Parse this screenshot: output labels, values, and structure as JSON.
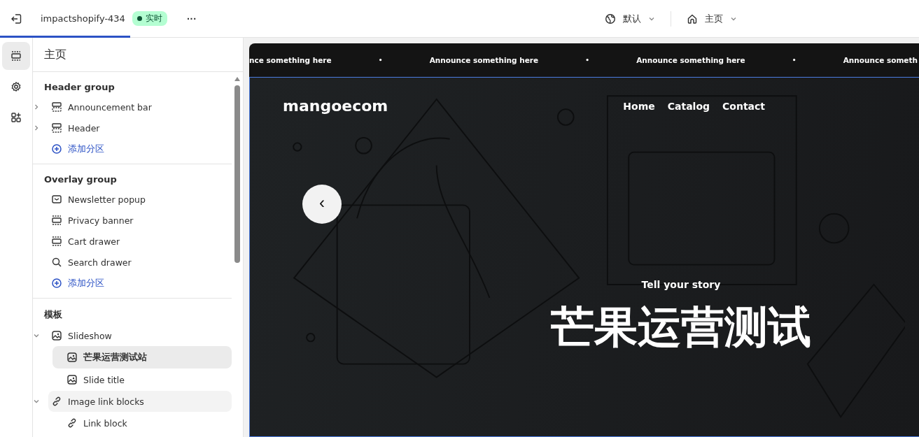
{
  "topbar": {
    "store_name": "impactshopify-434",
    "status_badge": "实时",
    "more": "···",
    "language": "默认",
    "page": "主页"
  },
  "rail": [
    {
      "kind": "sections",
      "selected": true
    },
    {
      "kind": "settings",
      "selected": false
    },
    {
      "kind": "apps",
      "selected": false
    }
  ],
  "panel": {
    "title": "主页",
    "groups": [
      {
        "title": "Header group",
        "items": [
          {
            "kind": "group-section",
            "label": "Announcement bar",
            "expanded": false,
            "selected": false
          },
          {
            "kind": "group-section",
            "label": "Header",
            "expanded": false,
            "selected": false
          },
          {
            "kind": "add",
            "label": "添加分区"
          }
        ]
      },
      {
        "title": "Overlay group",
        "items": [
          {
            "kind": "popup",
            "label": "Newsletter popup",
            "selected": false
          },
          {
            "kind": "overlay",
            "label": "Privacy banner",
            "selected": false
          },
          {
            "kind": "overlay",
            "label": "Cart drawer",
            "selected": false
          },
          {
            "kind": "search-overlay",
            "label": "Search drawer",
            "selected": false
          },
          {
            "kind": "add",
            "label": "添加分区"
          }
        ]
      },
      {
        "title": "模板",
        "items": [
          {
            "kind": "image-section",
            "label": "Slideshow",
            "expanded": true,
            "selected": false,
            "children": [
              {
                "kind": "image-block",
                "label": "芒果运营测试站",
                "selected": true
              },
              {
                "kind": "image-block",
                "label": "Slide title",
                "selected": false
              }
            ]
          },
          {
            "kind": "link-section",
            "label": "Image link blocks",
            "expanded": true,
            "selected": false,
            "hovered": true,
            "children": [
              {
                "kind": "link-block",
                "label": "Link block",
                "selected": false
              }
            ]
          }
        ]
      }
    ]
  },
  "preview": {
    "announcements": [
      {
        "kind": "text",
        "text": "nce something here"
      },
      {
        "kind": "dot",
        "text": "•"
      },
      {
        "kind": "text",
        "text": "Announce something here"
      },
      {
        "kind": "dot",
        "text": "•"
      },
      {
        "kind": "text",
        "text": "Announce something here"
      },
      {
        "kind": "dot",
        "text": "•"
      },
      {
        "kind": "text",
        "text": "Announce someth"
      }
    ],
    "logo": "mangoecom",
    "nav": [
      "Home",
      "Catalog",
      "Contact"
    ],
    "prev_button": "‹",
    "subheading": "Tell your story",
    "heading": "芒果运营测试"
  }
}
